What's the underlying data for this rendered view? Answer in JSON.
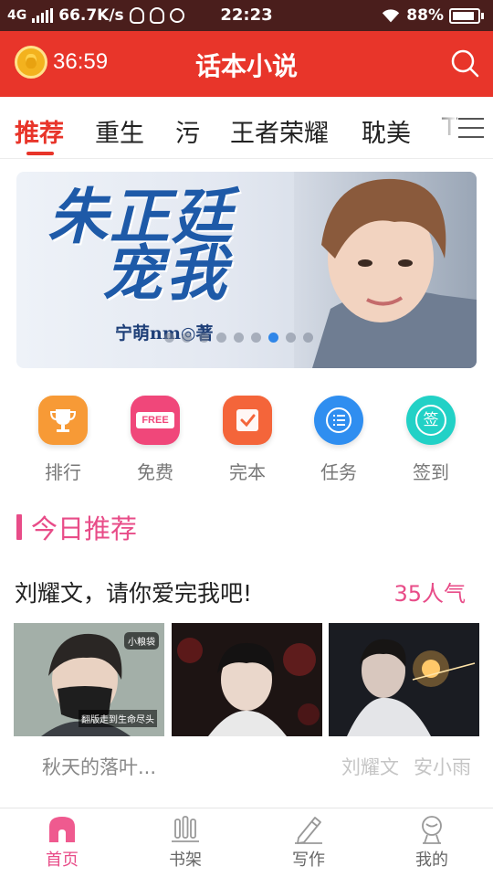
{
  "status_bar": {
    "network": "4G",
    "speed": "66.7K/s",
    "time": "22:23",
    "battery_pct": "88%",
    "battery_level": 0.88
  },
  "app_bar": {
    "timer": "36:59",
    "title": "话本小说"
  },
  "tabs": [
    {
      "label": "推荐",
      "active": true
    },
    {
      "label": "重生"
    },
    {
      "label": "污"
    },
    {
      "label": "王者荣耀"
    },
    {
      "label": "耽美"
    },
    {
      "label": "T"
    }
  ],
  "banner": {
    "title_line1": "朱正廷",
    "title_line2": "宠我",
    "author": "宁萌nm◎著",
    "slides": 9,
    "active_slide": 6
  },
  "quick_nav": [
    {
      "label": "排行",
      "icon": "trophy-icon",
      "color": "#f79a36"
    },
    {
      "label": "免费",
      "icon": "free-tag-icon",
      "badge": "FREE",
      "color": "#f0477a"
    },
    {
      "label": "完本",
      "icon": "checkbox-icon",
      "color": "#f4653a"
    },
    {
      "label": "任务",
      "icon": "list-icon",
      "color": "#2f8ef0"
    },
    {
      "label": "签到",
      "icon": "sign-in-icon",
      "badge": "签",
      "color": "#22d1c6"
    }
  ],
  "section": {
    "title": "今日推荐"
  },
  "book": {
    "title": "刘耀文，请你爱完我吧!",
    "popularity": "35人气",
    "covers": [
      {
        "tag": "小粮袋",
        "caption": "翻版走到生命尽头"
      },
      {},
      {}
    ],
    "description": "秋天的落叶...",
    "tags": [
      "刘耀文",
      "安小雨"
    ]
  },
  "bottom_nav": [
    {
      "label": "首页",
      "icon": "home-icon",
      "active": true
    },
    {
      "label": "书架",
      "icon": "bookshelf-icon"
    },
    {
      "label": "写作",
      "icon": "pencil-icon"
    },
    {
      "label": "我的",
      "icon": "profile-icon"
    }
  ],
  "colors": {
    "app_bar": "#e8352a",
    "accent_pink": "#e84c88",
    "status_bar": "#4a1e1c",
    "dot_active": "#2f86e8"
  }
}
